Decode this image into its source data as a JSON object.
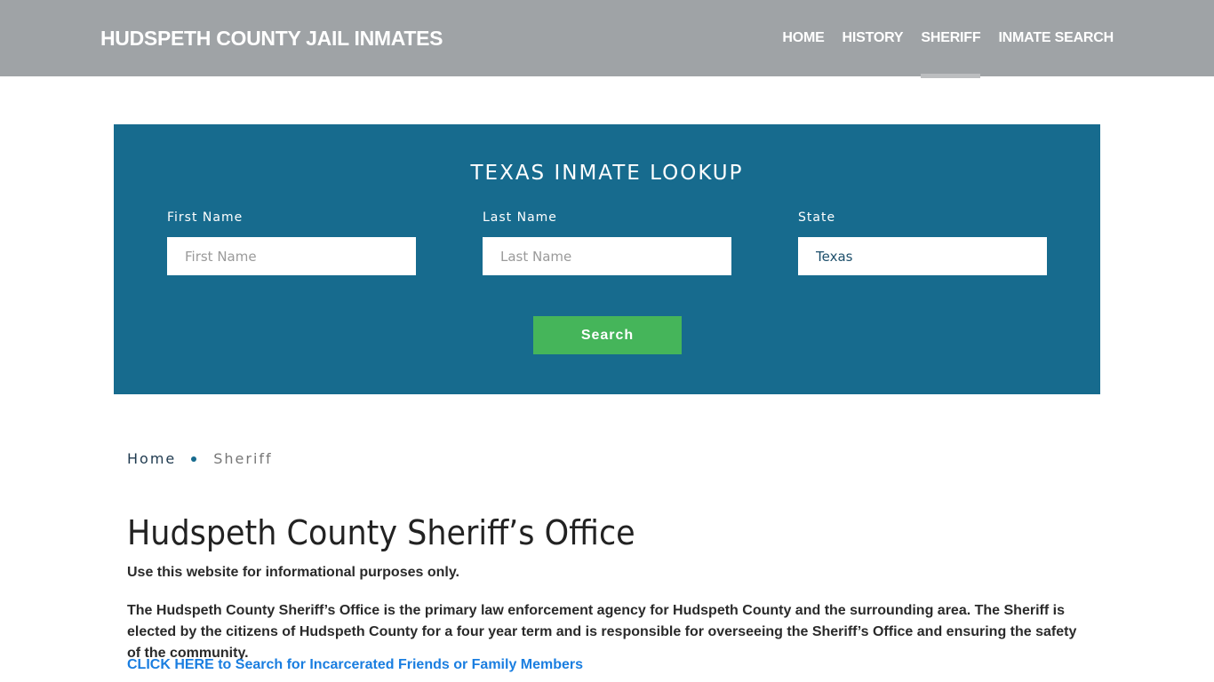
{
  "header": {
    "brand": "HUDSPETH COUNTY JAIL INMATES",
    "nav": [
      {
        "label": "HOME",
        "active": false
      },
      {
        "label": "HISTORY",
        "active": false
      },
      {
        "label": "SHERIFF",
        "active": true
      },
      {
        "label": "INMATE SEARCH",
        "active": false
      }
    ]
  },
  "lookup": {
    "title": "TEXAS INMATE LOOKUP",
    "first_name": {
      "label": "First Name",
      "placeholder": "First Name",
      "value": ""
    },
    "last_name": {
      "label": "Last Name",
      "placeholder": "Last Name",
      "value": ""
    },
    "state": {
      "label": "State",
      "value": "Texas"
    },
    "search_label": "Search"
  },
  "breadcrumb": {
    "home": "Home",
    "current": "Sheriff"
  },
  "content": {
    "title": "Hudspeth County Sheriff’s Office",
    "note": "Use this website for informational purposes only.",
    "paragraph": "The Hudspeth County Sheriff’s Office is the primary law enforcement agency for Hudspeth County and the surrounding area. The Sheriff is elected by the citizens of Hudspeth County for a four year term and is responsible for overseeing the Sheriff’s Office and ensuring the safety of the community.",
    "cta_link": "CLICK HERE to Search for Incarcerated Friends or Family Members"
  },
  "colors": {
    "header_bg": "#9fa3a6",
    "lookup_bg": "#176b8e",
    "search_button": "#45b55a",
    "link": "#1a7ee0"
  }
}
